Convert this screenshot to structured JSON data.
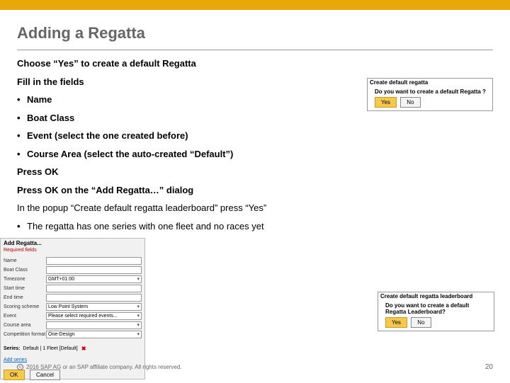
{
  "accent": "#e8a80a",
  "title": "Adding a Regatta",
  "lines": {
    "l1": "Choose “Yes” to create a default Regatta",
    "l2": "Fill in the fields",
    "b1": "Name",
    "b2": "Boat Class",
    "b3": "Event (select the one created before)",
    "b4": "Course Area (select the auto-created “Default”)",
    "l3": "Press OK",
    "l4": "Press OK on the “Add Regatta…” dialog",
    "l5": "In the popup “Create default regatta leaderboard” press “Yes”",
    "b5": "The regatta has one series with one fleet and no races yet"
  },
  "dialog1": {
    "title": "Create default regatta",
    "question": "Do you want to create a default Regatta ?",
    "yes": "Yes",
    "no": "No"
  },
  "dialog2": {
    "title": "Add Regatta...",
    "subtitle": "Required fields",
    "fields": {
      "name_label": "Name",
      "boatclass_label": "Boat Class",
      "timezone_label": "Timezone",
      "timezone_value": "GMT+01:00",
      "starttime_label": "Start time",
      "endtime_label": "End time",
      "scoring_label": "Scoring scheme",
      "scoring_value": "Low Point System",
      "event_label": "Event",
      "event_value": "Please select required events...",
      "coursearea_label": "Course area",
      "competition_label": "Competition format",
      "competition_value": "One-Design"
    },
    "series_label": "Series:",
    "series_value": "Default | 1 Fleet [Default]",
    "add_series": "Add series",
    "ok": "OK",
    "cancel": "Cancel"
  },
  "dialog3": {
    "title": "Create default regatta leaderboard",
    "question": "Do you want to create a default Regatta Leaderboard?",
    "yes": "Yes",
    "no": "No"
  },
  "footer": {
    "copyright": "2016 SAP AG or an SAP affiliate company. All rights reserved.",
    "page": "20"
  }
}
